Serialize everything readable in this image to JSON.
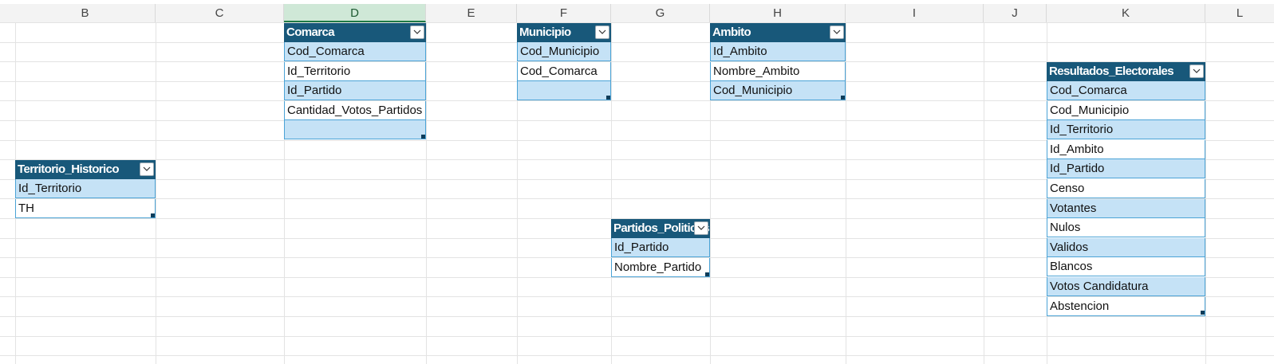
{
  "sheet": {
    "columns": [
      "B",
      "C",
      "D",
      "E",
      "F",
      "G",
      "H",
      "I",
      "J",
      "K",
      "L"
    ],
    "selected_column": "D"
  },
  "tables": [
    {
      "id": "comarca",
      "header": "Comarca",
      "rows": [
        "Cod_Comarca",
        "Id_Territorio",
        "Id_Partido",
        "Cantidad_Votos_Partidos",
        ""
      ]
    },
    {
      "id": "municipio",
      "header": "Municipio",
      "rows": [
        "Cod_Municipio",
        "Cod_Comarca",
        ""
      ]
    },
    {
      "id": "ambito",
      "header": "Ambito",
      "rows": [
        "Id_Ambito",
        "Nombre_Ambito",
        "Cod_Municipio"
      ]
    },
    {
      "id": "resultados-electorales",
      "header": "Resultados_Electorales",
      "rows": [
        "Cod_Comarca",
        "Cod_Municipio",
        "Id_Territorio",
        "Id_Ambito",
        "Id_Partido",
        "Censo",
        "Votantes",
        "Nulos",
        "Validos",
        "Blancos",
        "Votos Candidatura",
        "Abstencion"
      ]
    },
    {
      "id": "territorio-historico",
      "header": "Territorio_Historico",
      "rows": [
        "Id_Territorio",
        "TH"
      ]
    },
    {
      "id": "partidos-politicos",
      "header": "Partidos_Politicos",
      "rows": [
        "Id_Partido",
        "Nombre_Partido"
      ]
    }
  ],
  "colors": {
    "table_header": "#18587a",
    "band_fill": "#c5e2f6",
    "table_border": "#4ba3d6",
    "selected_header": "#cfe8d7"
  },
  "icons": {
    "filter": "chevron-down-icon",
    "resize": "resize-handle-icon"
  }
}
